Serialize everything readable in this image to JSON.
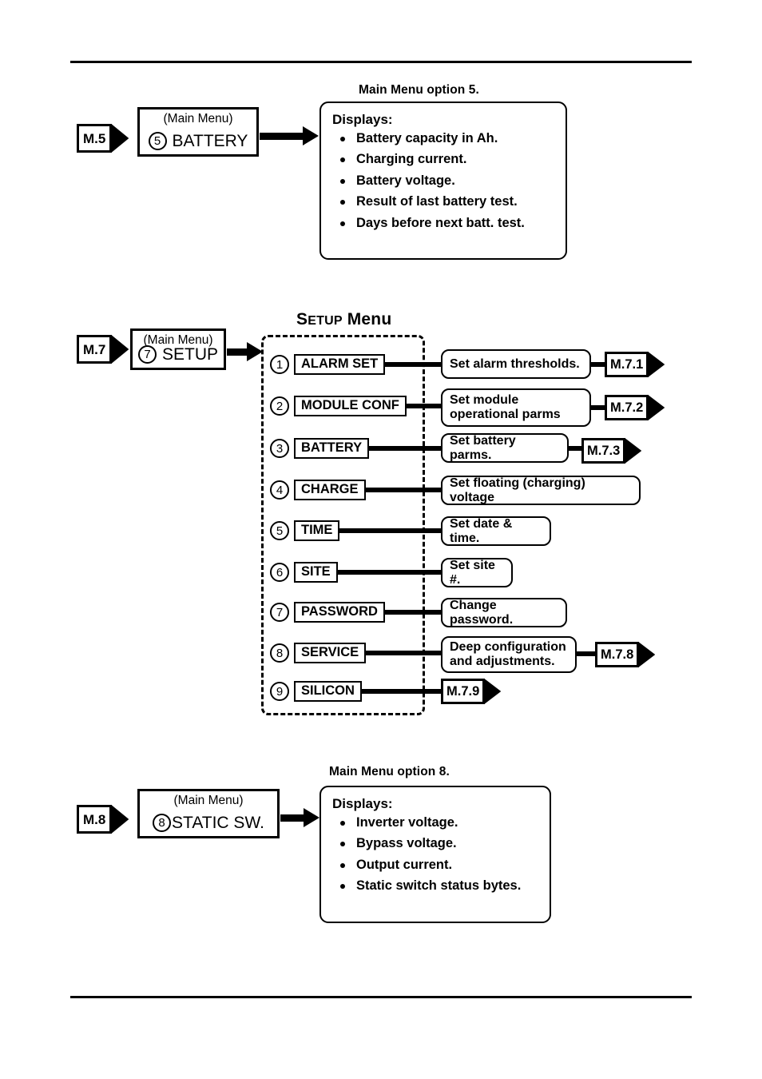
{
  "page": {
    "rules": {
      "top": "",
      "bottom": ""
    }
  },
  "section_m5": {
    "caption": "Main Menu option 5.",
    "entry_tag": "M.5",
    "menu_box": {
      "sub": "(Main Menu)",
      "number": "5",
      "label": "BATTERY"
    },
    "displays": {
      "heading": "Displays:",
      "items": [
        "Battery capacity in Ah.",
        "Charging current.",
        "Battery voltage.",
        "Result of last battery test.",
        "Days before next batt. test."
      ]
    }
  },
  "section_m7": {
    "title_first": "S",
    "title_smallcaps": "ETUP",
    "title_rest": " Menu",
    "entry_tag": "M.7",
    "menu_box": {
      "sub": "(Main Menu)",
      "number": "7",
      "label": "SETUP"
    },
    "items": [
      {
        "number": "1",
        "label": "ALARM SET",
        "description": "Set alarm thresholds.",
        "exit_tag": "M.7.1"
      },
      {
        "number": "2",
        "label": "MODULE CONF",
        "description": "Set module\noperational parms",
        "exit_tag": "M.7.2"
      },
      {
        "number": "3",
        "label": "BATTERY",
        "description": "Set battery parms.",
        "exit_tag": "M.7.3"
      },
      {
        "number": "4",
        "label": "CHARGE",
        "description": "Set floating (charging) voltage",
        "exit_tag": ""
      },
      {
        "number": "5",
        "label": "TIME",
        "description": "Set date & time.",
        "exit_tag": ""
      },
      {
        "number": "6",
        "label": "SITE",
        "description": "Set site #.",
        "exit_tag": ""
      },
      {
        "number": "7",
        "label": "PASSWORD",
        "description": "Change password.",
        "exit_tag": ""
      },
      {
        "number": "8",
        "label": "SERVICE",
        "description": "Deep configuration\nand adjustments.",
        "exit_tag": "M.7.8"
      },
      {
        "number": "9",
        "label": "SILICON",
        "description": "",
        "exit_tag": "M.7.9"
      }
    ]
  },
  "section_m8": {
    "caption": "Main Menu option 8.",
    "entry_tag": "M.8",
    "menu_box": {
      "sub": "(Main Menu)",
      "number": "8",
      "label": "STATIC SW."
    },
    "displays": {
      "heading": "Displays:",
      "items": [
        "Inverter voltage.",
        "Bypass voltage.",
        "Output current.",
        "Static switch status bytes."
      ]
    }
  }
}
